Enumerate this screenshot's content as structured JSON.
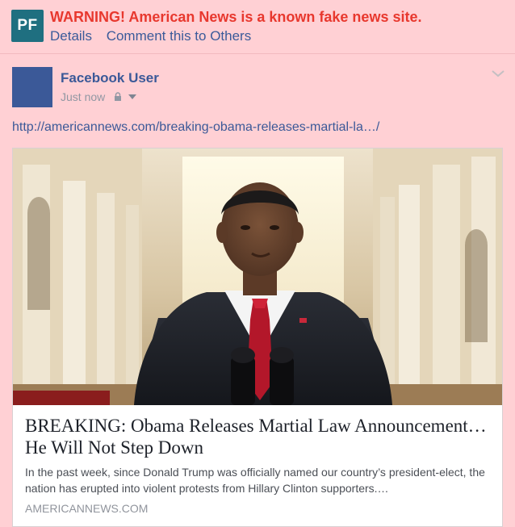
{
  "warning": {
    "logo_text": "PF",
    "message": "WARNING! American News is a known fake news site.",
    "details_link": "Details",
    "comment_link": "Comment this to Others"
  },
  "post": {
    "author": "Facebook User",
    "timestamp": "Just now",
    "privacy_icon": "lock-icon",
    "link_url": "http://americannews.com/breaking-obama-releases-martial-la…/"
  },
  "link_preview": {
    "title": "BREAKING: Obama Releases Martial Law Announcement… He Will Not Step Down",
    "description": "In the past week, since Donald Trump was officially named our country’s president-elect, the nation has erupted into violent protests from Hillary Clinton supporters.…",
    "domain": "AMERICANNEWS.COM"
  },
  "colors": {
    "warning_background": "#ffd0d4",
    "warning_text": "#e8382e",
    "link_blue": "#3b5998",
    "logo_teal": "#1f6f80"
  }
}
